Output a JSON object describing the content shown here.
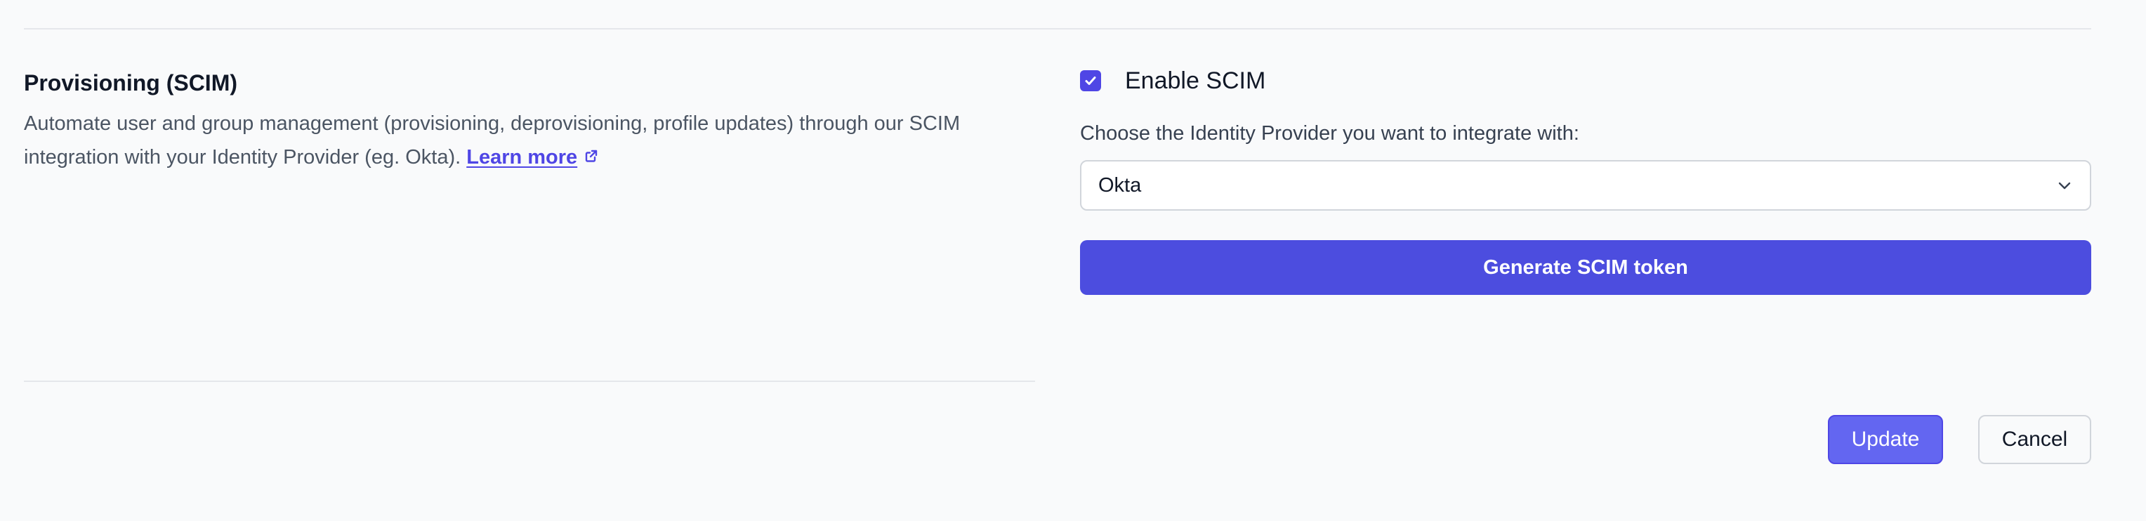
{
  "section": {
    "title": "Provisioning (SCIM)",
    "description": "Automate user and group management (provisioning, deprovisioning, profile updates) through our SCIM integration with your Identity Provider (eg. Okta). ",
    "learn_more_label": "Learn more",
    "learn_more_icon": "external-link-icon"
  },
  "scim": {
    "enable_label": "Enable SCIM",
    "enabled": true,
    "provider_label": "Choose the Identity Provider you want to integrate with:",
    "provider_value": "Okta",
    "generate_label": "Generate SCIM token"
  },
  "actions": {
    "update_label": "Update",
    "cancel_label": "Cancel"
  },
  "colors": {
    "accent": "#4f46e5",
    "primary_button": "#4c4ddf",
    "update_button": "#6366f1",
    "background": "#f9fafb"
  }
}
